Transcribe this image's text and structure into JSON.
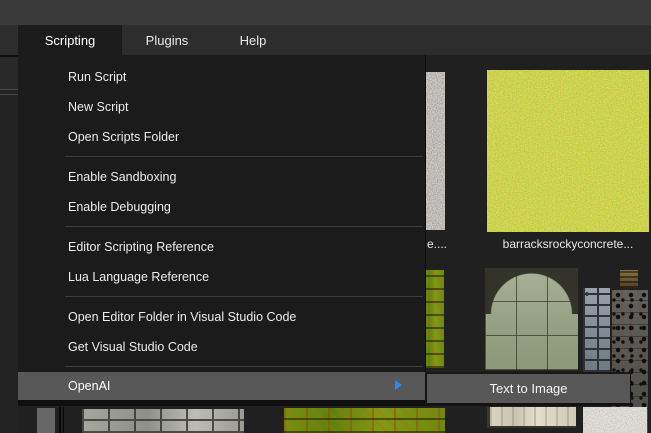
{
  "menubar": {
    "tabs": [
      {
        "label": "Scripting",
        "active": true
      },
      {
        "label": "Plugins",
        "active": false
      },
      {
        "label": "Help",
        "active": false
      }
    ]
  },
  "menu": {
    "items": [
      "Run Script",
      "New Script",
      "Open Scripts Folder",
      "Enable Sandboxing",
      "Enable Debugging",
      "Editor Scripting Reference",
      "Lua Language Reference",
      "Open Editor Folder in Visual Studio Code",
      "Get Visual Studio Code"
    ],
    "openai": {
      "label": "OpenAI",
      "has_submenu": true
    },
    "submenu": {
      "items": [
        {
          "label": "Text to Image"
        }
      ]
    },
    "colors": {
      "panel_bg": "#1b1b1b",
      "highlight": "#585858",
      "submenu_arrow": "#2e86ff"
    }
  },
  "content": {
    "thumbnails": [
      {
        "id": "clipped-left-texture",
        "label": "e...."
      },
      {
        "id": "barracks-rocky-concrete",
        "label": "barracksrockyconcrete..."
      }
    ]
  }
}
